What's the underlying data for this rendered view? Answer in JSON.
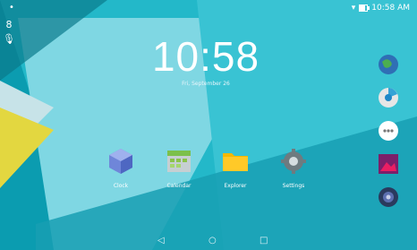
{
  "status_bar": {
    "left_icon": "notification-dot-icon",
    "right_icons": [
      "wifi-icon",
      "battery-icon"
    ],
    "battery_fraction": 0.7,
    "time": "10:58 AM"
  },
  "left_rail": {
    "items": [
      {
        "icon": "google-search-icon",
        "label": "8"
      },
      {
        "icon": "microphone-icon",
        "label": "🎙"
      }
    ]
  },
  "clock_widget": {
    "time": "10:58",
    "date": "Fri, September 26"
  },
  "apps": [
    {
      "name": "clock",
      "label": "Clock",
      "icon": "clock-app-icon"
    },
    {
      "name": "calendar",
      "label": "Calendar",
      "icon": "calendar-app-icon"
    },
    {
      "name": "explorer",
      "label": "Explorer",
      "icon": "folder-app-icon"
    },
    {
      "name": "settings",
      "label": "Settings",
      "icon": "gear-app-icon"
    }
  ],
  "right_dock": {
    "items": [
      {
        "icon": "browser-globe-icon"
      },
      {
        "icon": "chrome-like-icon"
      },
      {
        "icon": "app-drawer-icon"
      },
      {
        "icon": "gallery-icon"
      },
      {
        "icon": "music-speaker-icon"
      }
    ]
  },
  "nav_bar": {
    "back": "◁",
    "home": "○",
    "recents": "□"
  },
  "colors": {
    "wallpaper_dark": "#0fa3b6",
    "wallpaper_light": "#4dd0e1",
    "wallpaper_pale": "#a9e7ef",
    "accent_yellow": "#e2d335",
    "text": "#ffffff"
  }
}
